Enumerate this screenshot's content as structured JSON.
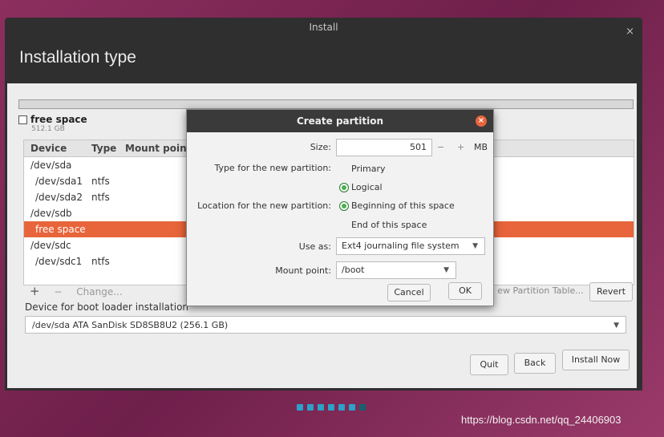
{
  "window": {
    "title": "Install",
    "close_glyph": "×"
  },
  "page_title": "Installation type",
  "free_space_legend": {
    "label": "free space",
    "size": "512.1 GB"
  },
  "table": {
    "headers": [
      "Device",
      "Type",
      "Mount point"
    ],
    "rows": [
      {
        "device": "/dev/sda",
        "type": ""
      },
      {
        "device": "/dev/sda1",
        "type": "ntfs"
      },
      {
        "device": "/dev/sda2",
        "type": "ntfs"
      },
      {
        "device": "/dev/sdb",
        "type": ""
      },
      {
        "device": "free space",
        "type": "",
        "selected": true
      },
      {
        "device": "/dev/sdc",
        "type": ""
      },
      {
        "device": "/dev/sdc1",
        "type": "ntfs"
      }
    ]
  },
  "toolbar": {
    "add": "+",
    "remove": "−",
    "change": "Change...",
    "new_table": "ew Partition Table...",
    "revert": "Revert"
  },
  "bootloader": {
    "label": "Device for boot loader installation",
    "value": "/dev/sda   ATA SanDisk SD8SB8U2 (256.1 GB)"
  },
  "buttons": {
    "quit": "Quit",
    "back": "Back",
    "install": "Install Now"
  },
  "dialog": {
    "title": "Create partition",
    "size_label": "Size:",
    "size_value": "501",
    "size_minus": "−",
    "size_plus": "+",
    "size_unit": "MB",
    "type_label": "Type for the new partition:",
    "type_primary": "Primary",
    "type_logical": "Logical",
    "type_selected": "Logical",
    "location_label": "Location for the new partition:",
    "loc_begin": "Beginning of this space",
    "loc_end": "End of this space",
    "loc_selected": "Beginning of this space",
    "use_as_label": "Use as:",
    "use_as_value": "Ext4 journaling file system",
    "mount_label": "Mount point:",
    "mount_value": "/boot",
    "cancel": "Cancel",
    "ok": "OK"
  },
  "progress_dots": {
    "active": 6,
    "total": 7
  },
  "watermark": "https://blog.csdn.net/qq_24406903",
  "colors": {
    "accent": "#e8643a",
    "radio_on": "#4caf50",
    "dot": "#2aa2c9"
  }
}
